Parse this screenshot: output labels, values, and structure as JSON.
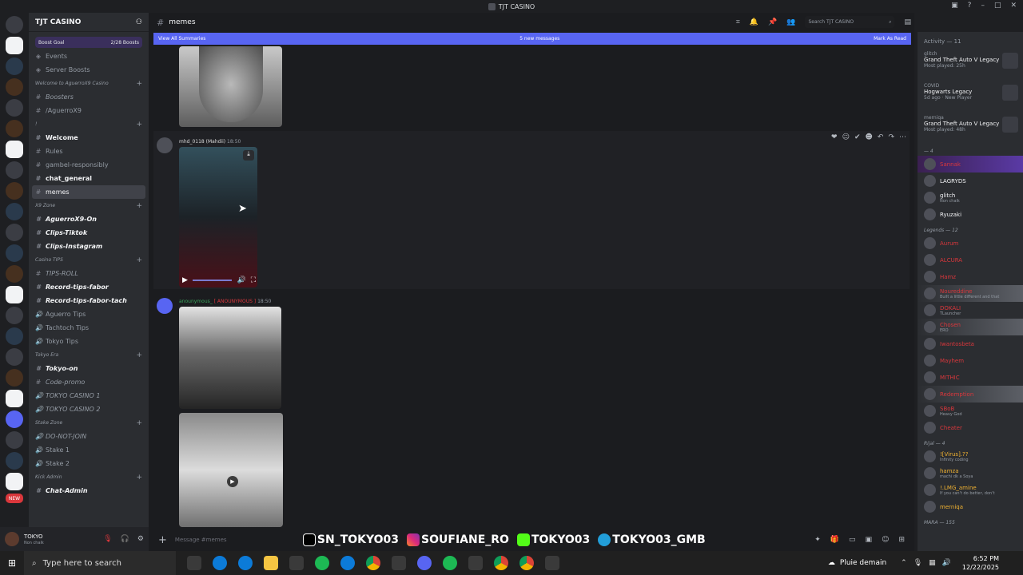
{
  "window": {
    "title": "TJT CASINO"
  },
  "guild": {
    "name": "TJT CASINO",
    "boost_label": "Boost Goal",
    "boost_count": "2/28 Boosts"
  },
  "channels": [
    {
      "type": "item",
      "label": "Events",
      "icon": "calendar-icon"
    },
    {
      "type": "item",
      "label": "Server Boosts",
      "icon": "boost-icon"
    },
    {
      "type": "cat",
      "label": "Welcome to AguerroX9 Casino"
    },
    {
      "type": "ch",
      "label": "Boosters",
      "style": "italic"
    },
    {
      "type": "ch",
      "label": "/AguerroX9",
      "style": ""
    },
    {
      "type": "cat",
      "label": "!"
    },
    {
      "type": "ch",
      "label": "Welcome",
      "style": "bold"
    },
    {
      "type": "ch",
      "label": "Rules",
      "style": ""
    },
    {
      "type": "ch",
      "label": "gambel-responsibly",
      "style": ""
    },
    {
      "type": "ch",
      "label": "chat_general",
      "style": "bold"
    },
    {
      "type": "ch",
      "label": "memes",
      "style": "active"
    },
    {
      "type": "cat",
      "label": "X9 Zone"
    },
    {
      "type": "ch",
      "label": "AguerroX9-On",
      "style": "bold italic"
    },
    {
      "type": "ch",
      "label": "Clips-Tiktok",
      "style": "bold italic"
    },
    {
      "type": "ch",
      "label": "Clips-Instagram",
      "style": "bold italic"
    },
    {
      "type": "cat",
      "label": "Casino TIPS"
    },
    {
      "type": "ch",
      "label": "TIPS-ROLL",
      "style": "italic"
    },
    {
      "type": "ch",
      "label": "Record-tips-fabor",
      "style": "bold italic"
    },
    {
      "type": "ch",
      "label": "Record-tips-fabor-tach",
      "style": "bold italic"
    },
    {
      "type": "voice",
      "label": "Aguerro Tips",
      "style": ""
    },
    {
      "type": "voice",
      "label": "Tachtoch Tips",
      "style": ""
    },
    {
      "type": "voice",
      "label": "Tokyo Tips",
      "style": ""
    },
    {
      "type": "cat",
      "label": "Tokyo Era"
    },
    {
      "type": "ch",
      "label": "Tokyo-on",
      "style": "bold italic"
    },
    {
      "type": "ch",
      "label": "Code-promo",
      "style": "italic"
    },
    {
      "type": "voice",
      "label": "TOKYO CASINO 1",
      "style": "italic"
    },
    {
      "type": "voice",
      "label": "TOKYO CASINO 2",
      "style": "italic"
    },
    {
      "type": "cat",
      "label": "Stake Zone"
    },
    {
      "type": "voice",
      "label": "DO-NOT-JOIN",
      "style": "italic"
    },
    {
      "type": "voice",
      "label": "Stake 1",
      "style": ""
    },
    {
      "type": "voice",
      "label": "Stake 2",
      "style": ""
    },
    {
      "type": "cat",
      "label": "Kick Admin"
    },
    {
      "type": "ch",
      "label": "Chat-Admin",
      "style": "bold italic"
    }
  ],
  "user": {
    "name": "TOKYO",
    "status": "Non chalk"
  },
  "channel_header": {
    "name": "memes",
    "search_placeholder": "Search TJT CASINO"
  },
  "banner": {
    "left": "View All Summaries",
    "center": "5 new messages",
    "right": "Mark As Read"
  },
  "messages": {
    "m1_author": "mhd_0118 (Mahdii)",
    "m1_time": "18:50",
    "m2_author": "anounymous_",
    "m2_tag": "[ ANOUNYMOUS ]",
    "m2_time": "18:50"
  },
  "composer": {
    "placeholder": "Message #memes",
    "overlay": [
      "SN_TOKYO03",
      "SOUFIANE_RO",
      "TOKYO03",
      "TOKYO03_GMB"
    ]
  },
  "members": {
    "activity_header": "Activity — 11",
    "activities": [
      {
        "user": "glitch",
        "game": "Grand Theft Auto V Legacy",
        "detail": "Most played: 25h"
      },
      {
        "user": "COVID",
        "game": "Hogwarts Legacy",
        "detail": "5d ago · New Player"
      },
      {
        "user": "merniqa",
        "game": "Grand Theft Auto V Legacy",
        "detail": "Most played: 48h"
      }
    ],
    "group1": "— 4",
    "group1_members": [
      {
        "name": "Sannak",
        "color": "",
        "status": ""
      },
      {
        "name": "LAGRYDS",
        "color": "w",
        "status": ""
      },
      {
        "name": "glitch",
        "color": "w",
        "status": "Non chalk"
      },
      {
        "name": "Ryuzaki",
        "color": "w",
        "status": ""
      }
    ],
    "group2": "Legends — 12",
    "group2_members": [
      {
        "name": "Aurum",
        "color": "",
        "status": ""
      },
      {
        "name": "ALCURA",
        "color": "",
        "status": ""
      },
      {
        "name": "Hamz",
        "color": "",
        "status": ""
      },
      {
        "name": "Noureddine",
        "color": "",
        "status": "Built a little different and that"
      },
      {
        "name": "DOKALI",
        "color": "",
        "status": "TLauncher"
      },
      {
        "name": "Chosen",
        "color": "",
        "status": "ERO"
      },
      {
        "name": "Iwantosbeta",
        "color": "",
        "status": ""
      },
      {
        "name": "Mayhem",
        "color": "",
        "status": ""
      },
      {
        "name": "MITHIC",
        "color": "",
        "status": ""
      },
      {
        "name": "Redemption",
        "color": "",
        "status": ""
      },
      {
        "name": "SBoB",
        "color": "",
        "status": "Heavy God"
      },
      {
        "name": "Cheater",
        "color": "",
        "status": ""
      }
    ],
    "group3": "Rijal — 4",
    "group3_members": [
      {
        "name": "![Virus].??",
        "color": "y",
        "status": "Infinity coding"
      },
      {
        "name": "hamza",
        "color": "y",
        "status": "machi dk a Soya"
      },
      {
        "name": "!.LMG_amine",
        "color": "y",
        "status": "If you can't do better, don't"
      },
      {
        "name": "merniqa",
        "color": "y",
        "status": ""
      }
    ],
    "group4": "MARA — 155"
  },
  "taskbar": {
    "search_placeholder": "Type here to search",
    "weather": "Pluie demain",
    "time": "6:52 PM",
    "date": "12/22/2025"
  }
}
